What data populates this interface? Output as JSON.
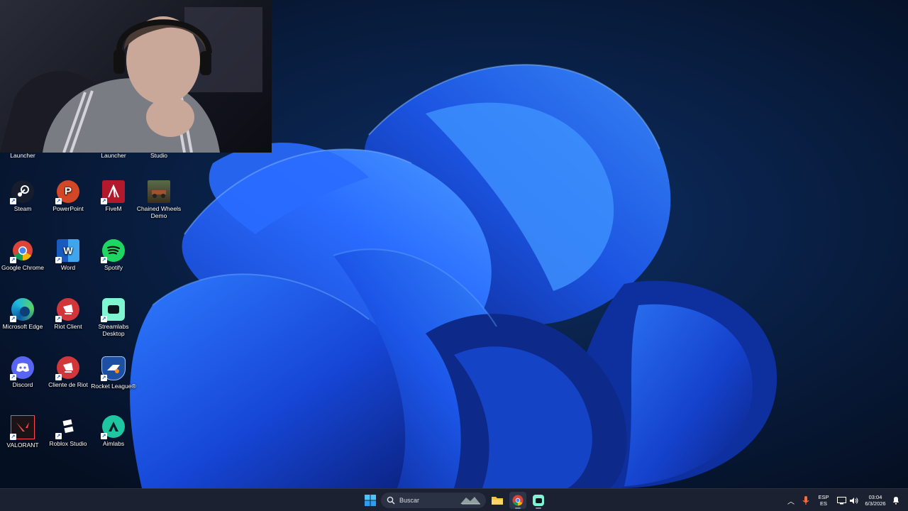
{
  "colors": {
    "desktop_bg": "#06152c",
    "taskbar_bg": "#1b2130",
    "bloom_primary": "#1a4fe0",
    "bloom_light": "#2f7bff"
  },
  "top_labels": [
    "Launcher",
    "Launcher",
    "Studio"
  ],
  "icons": {
    "steam": {
      "label": "Steam",
      "icon": "steam-icon"
    },
    "powerpoint": {
      "label": "PowerPoint",
      "icon": "powerpoint-icon"
    },
    "fivem": {
      "label": "FiveM",
      "icon": "fivem-icon"
    },
    "chained": {
      "label": "Chained Wheels Demo",
      "icon": "game-thumbnail-icon"
    },
    "chrome": {
      "label": "Google Chrome",
      "icon": "chrome-icon"
    },
    "word": {
      "label": "Word",
      "icon": "word-icon"
    },
    "spotify": {
      "label": "Spotify",
      "icon": "spotify-icon"
    },
    "edge": {
      "label": "Microsoft Edge",
      "icon": "edge-icon"
    },
    "riot": {
      "label": "Riot Client",
      "icon": "riot-icon"
    },
    "streamlabs": {
      "label": "Streamlabs Desktop",
      "icon": "streamlabs-icon"
    },
    "discord": {
      "label": "Discord",
      "icon": "discord-icon"
    },
    "cliente_riot": {
      "label": "Cliente de Riot",
      "icon": "riot-icon"
    },
    "rocket": {
      "label": "Rocket League®",
      "icon": "rocket-league-icon"
    },
    "valorant": {
      "label": "VALORANT",
      "icon": "valorant-icon"
    },
    "roblox": {
      "label": "Roblox Studio",
      "icon": "roblox-studio-icon"
    },
    "aimlabs": {
      "label": "Aimlabs",
      "icon": "aimlabs-icon"
    }
  },
  "taskbar": {
    "search_placeholder": "Buscar",
    "apps": [
      "windows-start-icon",
      "file-explorer-icon",
      "chrome-icon",
      "streamlabs-icon"
    ],
    "tray": {
      "lang_top": "ESP",
      "lang_bottom": "ES",
      "time": "03:04",
      "date": "6/3/2026"
    }
  }
}
